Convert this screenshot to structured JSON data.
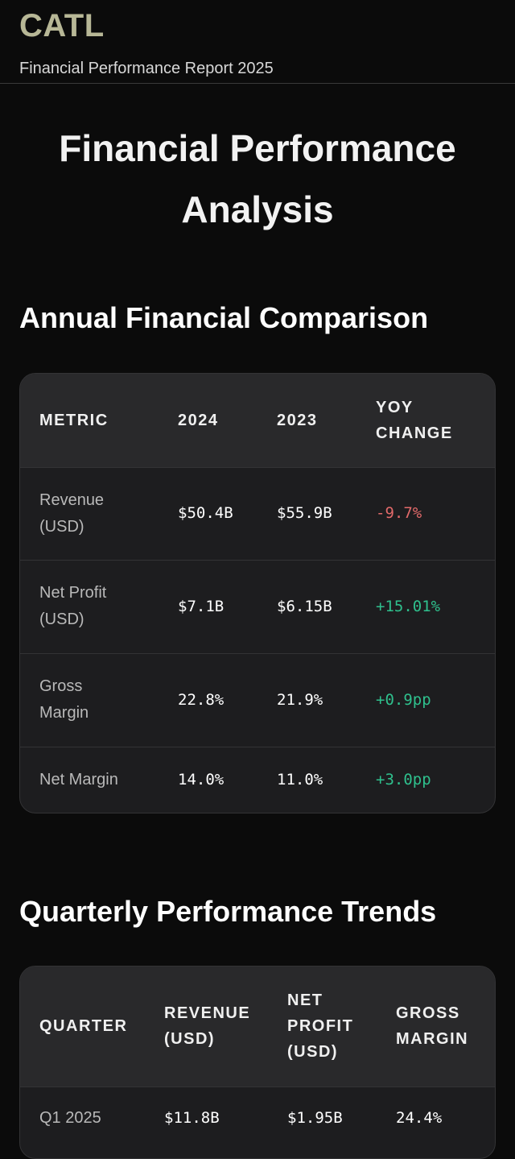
{
  "header": {
    "logo": "CATL",
    "subtitle": "Financial Performance Report 2025"
  },
  "hero": {
    "title": "Financial Performance Analysis"
  },
  "annual": {
    "title": "Annual Financial Comparison",
    "columns": [
      "METRIC",
      "2024",
      "2023",
      "YOY CHANGE"
    ],
    "rows": [
      {
        "metric": "Revenue (USD)",
        "y2024": "$50.4B",
        "y2023": "$55.9B",
        "change": "-9.7%",
        "trend": "negative"
      },
      {
        "metric": "Net Profit (USD)",
        "y2024": "$7.1B",
        "y2023": "$6.15B",
        "change": "+15.01%",
        "trend": "positive"
      },
      {
        "metric": "Gross Margin",
        "y2024": "22.8%",
        "y2023": "21.9%",
        "change": "+0.9pp",
        "trend": "positive"
      },
      {
        "metric": "Net Margin",
        "y2024": "14.0%",
        "y2023": "11.0%",
        "change": "+3.0pp",
        "trend": "positive"
      }
    ]
  },
  "quarterly": {
    "title": "Quarterly Performance Trends",
    "columns": [
      "QUARTER",
      "REVENUE (USD)",
      "NET PROFIT (USD)",
      "GROSS MARGIN"
    ],
    "rows": [
      {
        "quarter": "Q1 2025",
        "revenue": "$11.8B",
        "profit": "$1.95B",
        "margin": "24.4%"
      }
    ]
  },
  "colors": {
    "accent": "#b7b796",
    "negative": "#e26a6a",
    "positive": "#2fc08d",
    "background": "#0b0b0b",
    "card": "#1d1d1f"
  }
}
